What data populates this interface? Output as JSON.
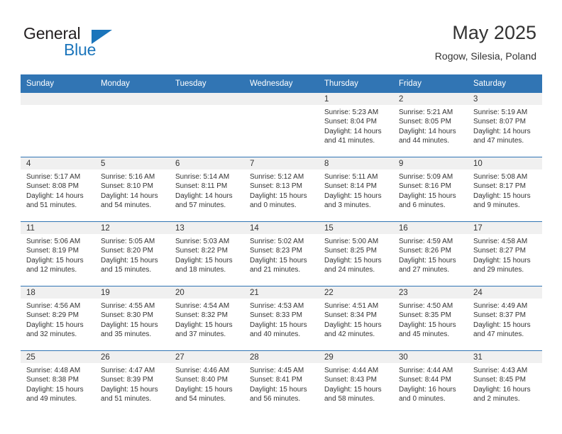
{
  "brand": {
    "word1": "General",
    "word2": "Blue",
    "mark": "triangle-logo"
  },
  "header": {
    "title": "May 2025",
    "subtitle": "Rogow, Silesia, Poland"
  },
  "colors": {
    "header_blue": "#3175b4",
    "brand_blue": "#1b75bb",
    "daynum_bg": "#f0f0f0",
    "text": "#333333"
  },
  "calendar": {
    "weekday_headers": [
      "Sunday",
      "Monday",
      "Tuesday",
      "Wednesday",
      "Thursday",
      "Friday",
      "Saturday"
    ],
    "weeks": [
      [
        {
          "day": "",
          "sunrise": "",
          "sunset": "",
          "daylight1": "",
          "daylight2": ""
        },
        {
          "day": "",
          "sunrise": "",
          "sunset": "",
          "daylight1": "",
          "daylight2": ""
        },
        {
          "day": "",
          "sunrise": "",
          "sunset": "",
          "daylight1": "",
          "daylight2": ""
        },
        {
          "day": "",
          "sunrise": "",
          "sunset": "",
          "daylight1": "",
          "daylight2": ""
        },
        {
          "day": "1",
          "sunrise": "Sunrise: 5:23 AM",
          "sunset": "Sunset: 8:04 PM",
          "daylight1": "Daylight: 14 hours",
          "daylight2": "and 41 minutes."
        },
        {
          "day": "2",
          "sunrise": "Sunrise: 5:21 AM",
          "sunset": "Sunset: 8:05 PM",
          "daylight1": "Daylight: 14 hours",
          "daylight2": "and 44 minutes."
        },
        {
          "day": "3",
          "sunrise": "Sunrise: 5:19 AM",
          "sunset": "Sunset: 8:07 PM",
          "daylight1": "Daylight: 14 hours",
          "daylight2": "and 47 minutes."
        }
      ],
      [
        {
          "day": "4",
          "sunrise": "Sunrise: 5:17 AM",
          "sunset": "Sunset: 8:08 PM",
          "daylight1": "Daylight: 14 hours",
          "daylight2": "and 51 minutes."
        },
        {
          "day": "5",
          "sunrise": "Sunrise: 5:16 AM",
          "sunset": "Sunset: 8:10 PM",
          "daylight1": "Daylight: 14 hours",
          "daylight2": "and 54 minutes."
        },
        {
          "day": "6",
          "sunrise": "Sunrise: 5:14 AM",
          "sunset": "Sunset: 8:11 PM",
          "daylight1": "Daylight: 14 hours",
          "daylight2": "and 57 minutes."
        },
        {
          "day": "7",
          "sunrise": "Sunrise: 5:12 AM",
          "sunset": "Sunset: 8:13 PM",
          "daylight1": "Daylight: 15 hours",
          "daylight2": "and 0 minutes."
        },
        {
          "day": "8",
          "sunrise": "Sunrise: 5:11 AM",
          "sunset": "Sunset: 8:14 PM",
          "daylight1": "Daylight: 15 hours",
          "daylight2": "and 3 minutes."
        },
        {
          "day": "9",
          "sunrise": "Sunrise: 5:09 AM",
          "sunset": "Sunset: 8:16 PM",
          "daylight1": "Daylight: 15 hours",
          "daylight2": "and 6 minutes."
        },
        {
          "day": "10",
          "sunrise": "Sunrise: 5:08 AM",
          "sunset": "Sunset: 8:17 PM",
          "daylight1": "Daylight: 15 hours",
          "daylight2": "and 9 minutes."
        }
      ],
      [
        {
          "day": "11",
          "sunrise": "Sunrise: 5:06 AM",
          "sunset": "Sunset: 8:19 PM",
          "daylight1": "Daylight: 15 hours",
          "daylight2": "and 12 minutes."
        },
        {
          "day": "12",
          "sunrise": "Sunrise: 5:05 AM",
          "sunset": "Sunset: 8:20 PM",
          "daylight1": "Daylight: 15 hours",
          "daylight2": "and 15 minutes."
        },
        {
          "day": "13",
          "sunrise": "Sunrise: 5:03 AM",
          "sunset": "Sunset: 8:22 PM",
          "daylight1": "Daylight: 15 hours",
          "daylight2": "and 18 minutes."
        },
        {
          "day": "14",
          "sunrise": "Sunrise: 5:02 AM",
          "sunset": "Sunset: 8:23 PM",
          "daylight1": "Daylight: 15 hours",
          "daylight2": "and 21 minutes."
        },
        {
          "day": "15",
          "sunrise": "Sunrise: 5:00 AM",
          "sunset": "Sunset: 8:25 PM",
          "daylight1": "Daylight: 15 hours",
          "daylight2": "and 24 minutes."
        },
        {
          "day": "16",
          "sunrise": "Sunrise: 4:59 AM",
          "sunset": "Sunset: 8:26 PM",
          "daylight1": "Daylight: 15 hours",
          "daylight2": "and 27 minutes."
        },
        {
          "day": "17",
          "sunrise": "Sunrise: 4:58 AM",
          "sunset": "Sunset: 8:27 PM",
          "daylight1": "Daylight: 15 hours",
          "daylight2": "and 29 minutes."
        }
      ],
      [
        {
          "day": "18",
          "sunrise": "Sunrise: 4:56 AM",
          "sunset": "Sunset: 8:29 PM",
          "daylight1": "Daylight: 15 hours",
          "daylight2": "and 32 minutes."
        },
        {
          "day": "19",
          "sunrise": "Sunrise: 4:55 AM",
          "sunset": "Sunset: 8:30 PM",
          "daylight1": "Daylight: 15 hours",
          "daylight2": "and 35 minutes."
        },
        {
          "day": "20",
          "sunrise": "Sunrise: 4:54 AM",
          "sunset": "Sunset: 8:32 PM",
          "daylight1": "Daylight: 15 hours",
          "daylight2": "and 37 minutes."
        },
        {
          "day": "21",
          "sunrise": "Sunrise: 4:53 AM",
          "sunset": "Sunset: 8:33 PM",
          "daylight1": "Daylight: 15 hours",
          "daylight2": "and 40 minutes."
        },
        {
          "day": "22",
          "sunrise": "Sunrise: 4:51 AM",
          "sunset": "Sunset: 8:34 PM",
          "daylight1": "Daylight: 15 hours",
          "daylight2": "and 42 minutes."
        },
        {
          "day": "23",
          "sunrise": "Sunrise: 4:50 AM",
          "sunset": "Sunset: 8:35 PM",
          "daylight1": "Daylight: 15 hours",
          "daylight2": "and 45 minutes."
        },
        {
          "day": "24",
          "sunrise": "Sunrise: 4:49 AM",
          "sunset": "Sunset: 8:37 PM",
          "daylight1": "Daylight: 15 hours",
          "daylight2": "and 47 minutes."
        }
      ],
      [
        {
          "day": "25",
          "sunrise": "Sunrise: 4:48 AM",
          "sunset": "Sunset: 8:38 PM",
          "daylight1": "Daylight: 15 hours",
          "daylight2": "and 49 minutes."
        },
        {
          "day": "26",
          "sunrise": "Sunrise: 4:47 AM",
          "sunset": "Sunset: 8:39 PM",
          "daylight1": "Daylight: 15 hours",
          "daylight2": "and 51 minutes."
        },
        {
          "day": "27",
          "sunrise": "Sunrise: 4:46 AM",
          "sunset": "Sunset: 8:40 PM",
          "daylight1": "Daylight: 15 hours",
          "daylight2": "and 54 minutes."
        },
        {
          "day": "28",
          "sunrise": "Sunrise: 4:45 AM",
          "sunset": "Sunset: 8:41 PM",
          "daylight1": "Daylight: 15 hours",
          "daylight2": "and 56 minutes."
        },
        {
          "day": "29",
          "sunrise": "Sunrise: 4:44 AM",
          "sunset": "Sunset: 8:43 PM",
          "daylight1": "Daylight: 15 hours",
          "daylight2": "and 58 minutes."
        },
        {
          "day": "30",
          "sunrise": "Sunrise: 4:44 AM",
          "sunset": "Sunset: 8:44 PM",
          "daylight1": "Daylight: 16 hours",
          "daylight2": "and 0 minutes."
        },
        {
          "day": "31",
          "sunrise": "Sunrise: 4:43 AM",
          "sunset": "Sunset: 8:45 PM",
          "daylight1": "Daylight: 16 hours",
          "daylight2": "and 2 minutes."
        }
      ]
    ]
  }
}
